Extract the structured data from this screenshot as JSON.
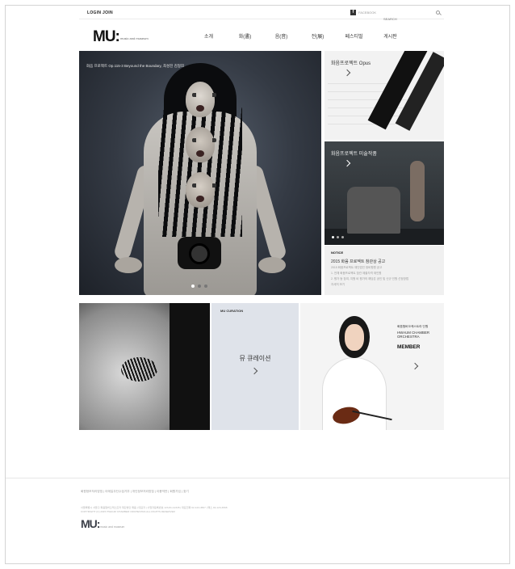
{
  "header": {
    "login": "LOGIN",
    "join": "JOIN",
    "facebook_icon": "f",
    "facebook_label": "FACEBOOK",
    "search_placeholder": "SEARCH",
    "logo": "MU:",
    "logo_sub": "music and museum",
    "nav": [
      "소개",
      "화(畵)",
      "음(音)",
      "전(展)",
      "페스티벌",
      "게시판"
    ]
  },
  "hero": {
    "caption": "화음 프로젝트 Op.115-3 Beyound the Boundary, 최성진 김형희",
    "slides": 3,
    "active_slide": 1
  },
  "cards": {
    "opus_title": "화음프로젝트 Opus",
    "exhibit_title": "화음프로젝트 미술작품",
    "notice": {
      "tag": "NOTICE",
      "title": "2015 화음 프로젝트 참관상 공고",
      "lines": [
        "2015 화음프로젝트 재단법인 정비평원 공고",
        "1. 전체 화음프로젝트 참관 제출자격 재인원",
        "2. 평가 등 참여, 지원 비 평가의 해당은 공인 및 신규 인원 선정방법",
        "자세히 보기"
      ]
    },
    "curation_tag": "MU CURATION",
    "curation_title": "뮤 큐레이션",
    "member_sub": "화음챔버오케스트라 단원",
    "member_org": "HWAUM CHAMBER ORCHESTRA",
    "member_title": "MEMBER"
  },
  "footer": {
    "links": "회원정보처리방침 | 이메일무단수집거부 | 개인정보처리방침 | 이용약관 | 회원가입 | 찾기",
    "address": "서울특별시 서울구 화음챔버오케스트라 재단법인 화음 | 대표자 | 사업자등록번호 123-81-12345 | 대표전화 02-123-4567 | 팩스 02-123-4568",
    "copyright": "COPYRIGHT (C) 2015 HWAUM CHAMBER ORCHESTRA ALL RIGHTS RESERVED",
    "logo": "MU:",
    "logo_sub": "music and museum"
  },
  "colors": {
    "hero_bg": "#343a44",
    "curation_bg": "#dfe3ea",
    "text": "#333333"
  }
}
